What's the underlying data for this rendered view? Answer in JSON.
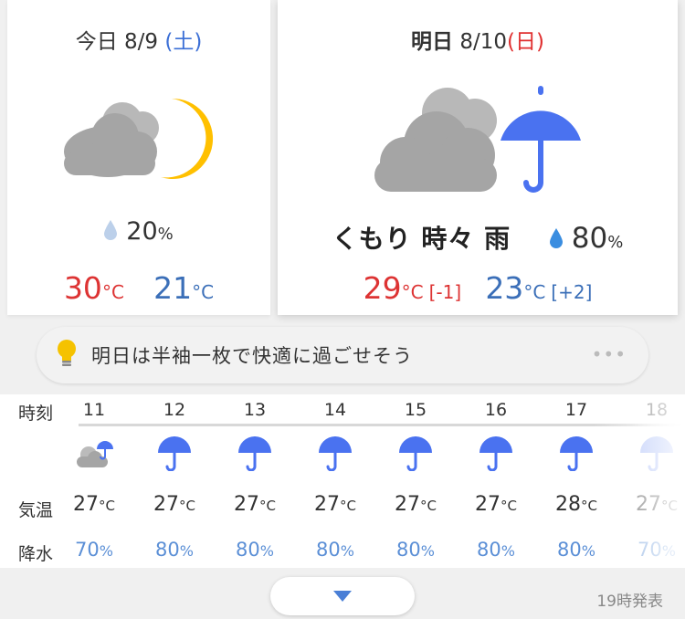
{
  "today": {
    "label": "今日",
    "date": "8/9",
    "dow": "(土)",
    "icon": "cloudy-night-icon",
    "precip": "20",
    "pct_unit": "%",
    "high": "30",
    "low": "21",
    "temp_unit": "°C"
  },
  "tomorrow": {
    "label": "明日",
    "date": "8/10",
    "dow": "(日)",
    "icon": "cloudy-rain-icon",
    "description": "くもり 時々 雨",
    "precip": "80",
    "pct_unit": "%",
    "high": "29",
    "high_diff": "[-1]",
    "low": "23",
    "low_diff": "[+2]",
    "temp_unit": "°C"
  },
  "comment": {
    "icon": "lightbulb-icon",
    "text": "明日は半袖一枚で快適に過ごせそう",
    "more": "•••"
  },
  "hourly": {
    "labels": {
      "time": "時刻",
      "temp": "気温",
      "precip": "降水"
    },
    "hours": [
      {
        "hour": "11",
        "icon": "cloud-umbrella-icon",
        "temp": "27",
        "precip": "70"
      },
      {
        "hour": "12",
        "icon": "umbrella-icon",
        "temp": "27",
        "precip": "80"
      },
      {
        "hour": "13",
        "icon": "umbrella-icon",
        "temp": "27",
        "precip": "80"
      },
      {
        "hour": "14",
        "icon": "umbrella-icon",
        "temp": "27",
        "precip": "80"
      },
      {
        "hour": "15",
        "icon": "umbrella-icon",
        "temp": "27",
        "precip": "80"
      },
      {
        "hour": "16",
        "icon": "umbrella-icon",
        "temp": "27",
        "precip": "80"
      },
      {
        "hour": "17",
        "icon": "umbrella-icon",
        "temp": "28",
        "precip": "80"
      },
      {
        "hour": "18",
        "icon": "umbrella-icon",
        "temp": "27",
        "precip": "70"
      }
    ],
    "temp_unit": "°C",
    "pct_unit": "%"
  },
  "footer": {
    "issued": "19時発表",
    "expand_icon": "chevron-down-icon"
  },
  "colors": {
    "sun": "#ffc000",
    "cloud": "#a5a5a5",
    "umbrella": "#4a72f0",
    "high": "#d33333",
    "low": "#3b6fb8",
    "sat": "#3b6fd6",
    "sun_day": "#e03030"
  }
}
